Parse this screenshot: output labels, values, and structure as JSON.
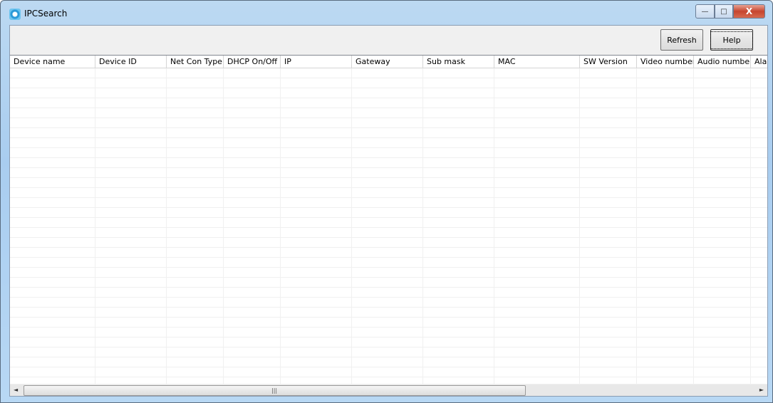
{
  "window": {
    "title": "IPCSearch",
    "minimize": "—",
    "maximize": "□",
    "close": "X"
  },
  "toolbar": {
    "refresh_label": "Refresh",
    "help_label": "Help"
  },
  "table": {
    "columns": [
      "Device name",
      "Device ID",
      "Net Con Type",
      "DHCP On/Off",
      "IP",
      "Gateway",
      "Sub mask",
      "MAC",
      "SW Version",
      "Video number",
      "Audio number",
      "Ala"
    ],
    "rows": []
  },
  "scrollbar": {
    "left_arrow": "◄",
    "right_arrow": "►",
    "grip": "|||"
  }
}
